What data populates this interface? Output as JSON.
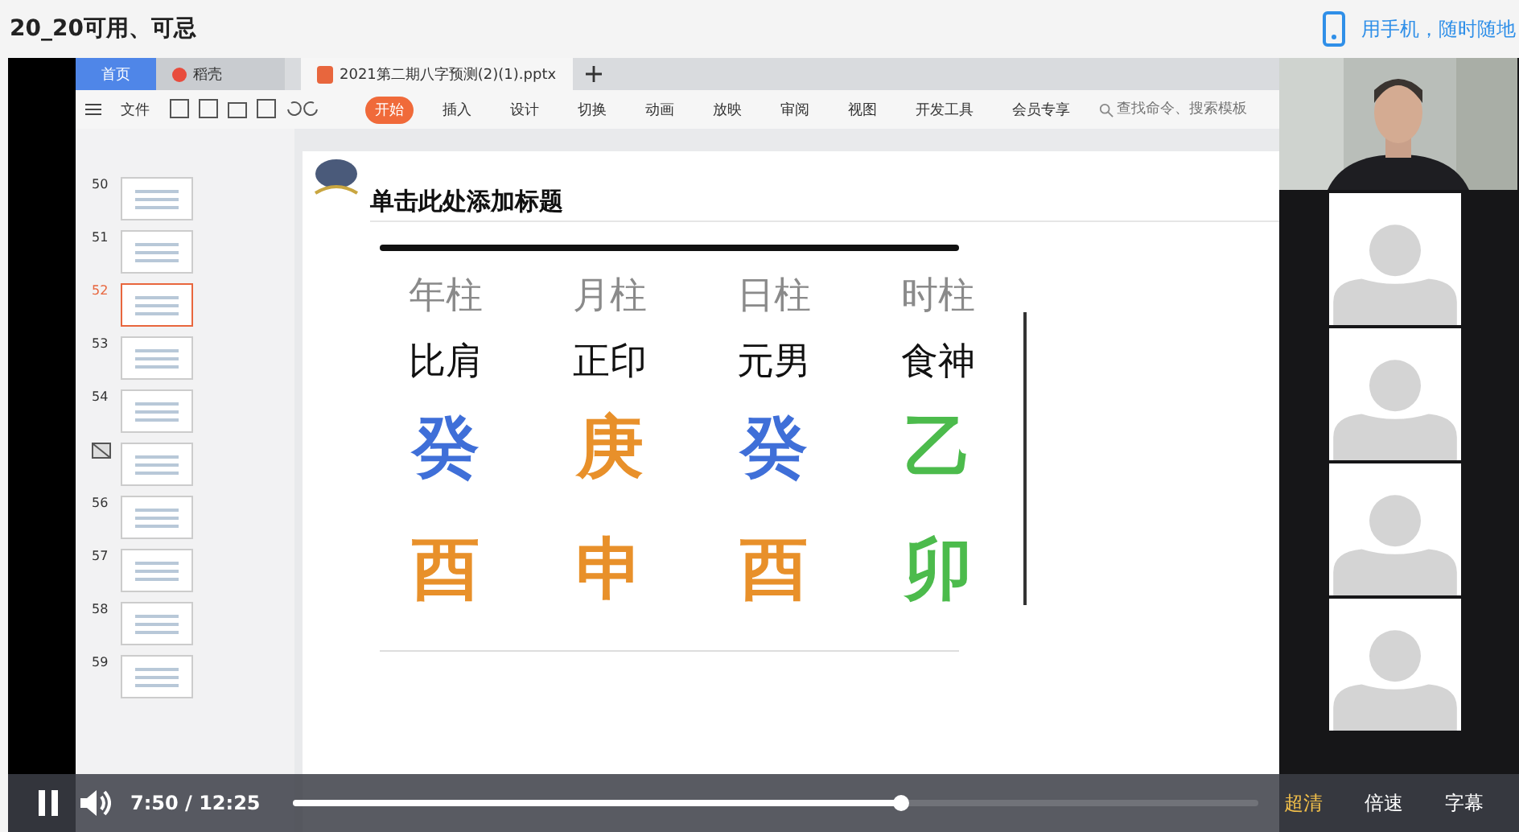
{
  "page": {
    "title": "20_20可用、可忌",
    "mobile_link": "用手机，随时随地"
  },
  "app_tabs": [
    {
      "label": "首页",
      "kind": "home",
      "selected": false
    },
    {
      "label": "稻壳",
      "kind": "docer",
      "selected": false
    },
    {
      "label": "2021第二期八字预测(2)(1).pptx",
      "kind": "file",
      "selected": true
    }
  ],
  "ribbon": {
    "file_menu": "文件",
    "tabs": [
      {
        "label": "开始",
        "selected": true
      },
      {
        "label": "插入",
        "selected": false
      },
      {
        "label": "设计",
        "selected": false
      },
      {
        "label": "切换",
        "selected": false
      },
      {
        "label": "动画",
        "selected": false
      },
      {
        "label": "放映",
        "selected": false
      },
      {
        "label": "审阅",
        "selected": false
      },
      {
        "label": "视图",
        "selected": false
      },
      {
        "label": "开发工具",
        "selected": false
      },
      {
        "label": "会员专享",
        "selected": false
      }
    ],
    "search": {
      "placeholder": "查找命令、搜索模板"
    }
  },
  "slides": [
    {
      "number": "50",
      "selected": false
    },
    {
      "number": "51",
      "selected": false
    },
    {
      "number": "52",
      "selected": true
    },
    {
      "number": "53",
      "selected": false
    },
    {
      "number": "54",
      "selected": false
    },
    {
      "selected": false
    },
    {
      "number": "56",
      "selected": false
    },
    {
      "number": "57",
      "selected": false
    },
    {
      "number": "58",
      "selected": false
    },
    {
      "number": "59",
      "selected": false
    }
  ],
  "slide": {
    "title": "单击此处添加标题",
    "headers": [
      "年柱",
      "月柱",
      "日柱",
      "时柱"
    ],
    "roles": [
      "比肩",
      "正印",
      "元男",
      "食神"
    ],
    "stems": [
      {
        "text": "癸",
        "color": "#3f6fd8"
      },
      {
        "text": "庚",
        "color": "#e8902a"
      },
      {
        "text": "癸",
        "color": "#3f6fd8"
      },
      {
        "text": "乙",
        "color": "#4cbb4c"
      }
    ],
    "branches": [
      {
        "text": "酉",
        "color": "#e8902a"
      },
      {
        "text": "申",
        "color": "#e8902a"
      },
      {
        "text": "酉",
        "color": "#e8902a"
      },
      {
        "text": "卯",
        "color": "#4cbb4c"
      }
    ]
  },
  "participants": [
    {
      "kind": "camera"
    },
    {
      "kind": "avatar"
    },
    {
      "kind": "avatar"
    },
    {
      "kind": "avatar"
    },
    {
      "kind": "avatar"
    }
  ],
  "player": {
    "playing": true,
    "time": "7:50",
    "separator": "/",
    "duration": "12:25",
    "level": 0.63,
    "quality": "超清",
    "speed": "倍速",
    "subtitles": "字幕"
  }
}
